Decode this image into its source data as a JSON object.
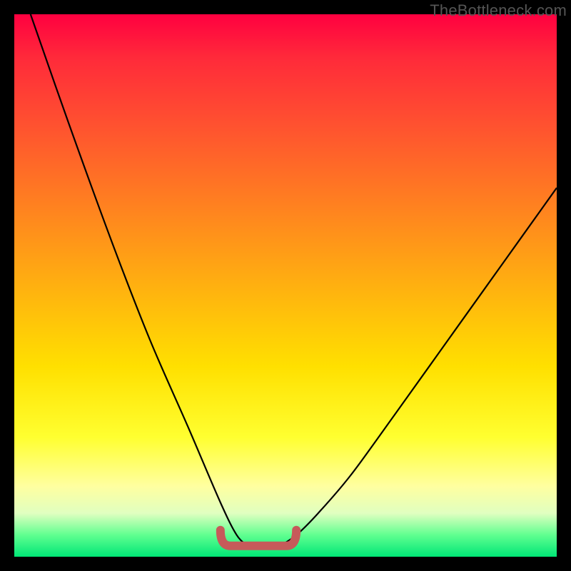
{
  "watermark": "TheBottleneck.com",
  "chart_data": {
    "type": "line",
    "title": "",
    "xlabel": "",
    "ylabel": "",
    "xlim": [
      0,
      100
    ],
    "ylim": [
      0,
      100
    ],
    "grid": false,
    "legend": false,
    "annotation_band": {
      "name": "optimal-range",
      "color": "#c65a5a",
      "x_start": 38,
      "x_end": 52,
      "y": 2
    },
    "series": [
      {
        "name": "left-curve",
        "color": "#000000",
        "x": [
          3,
          10,
          18,
          25,
          32,
          38,
          41,
          43
        ],
        "y": [
          100,
          80,
          58,
          40,
          24,
          10,
          4,
          2
        ]
      },
      {
        "name": "right-curve",
        "color": "#000000",
        "x": [
          49,
          52,
          56,
          62,
          70,
          80,
          90,
          100
        ],
        "y": [
          2,
          4,
          8,
          15,
          26,
          40,
          54,
          68
        ]
      }
    ]
  }
}
